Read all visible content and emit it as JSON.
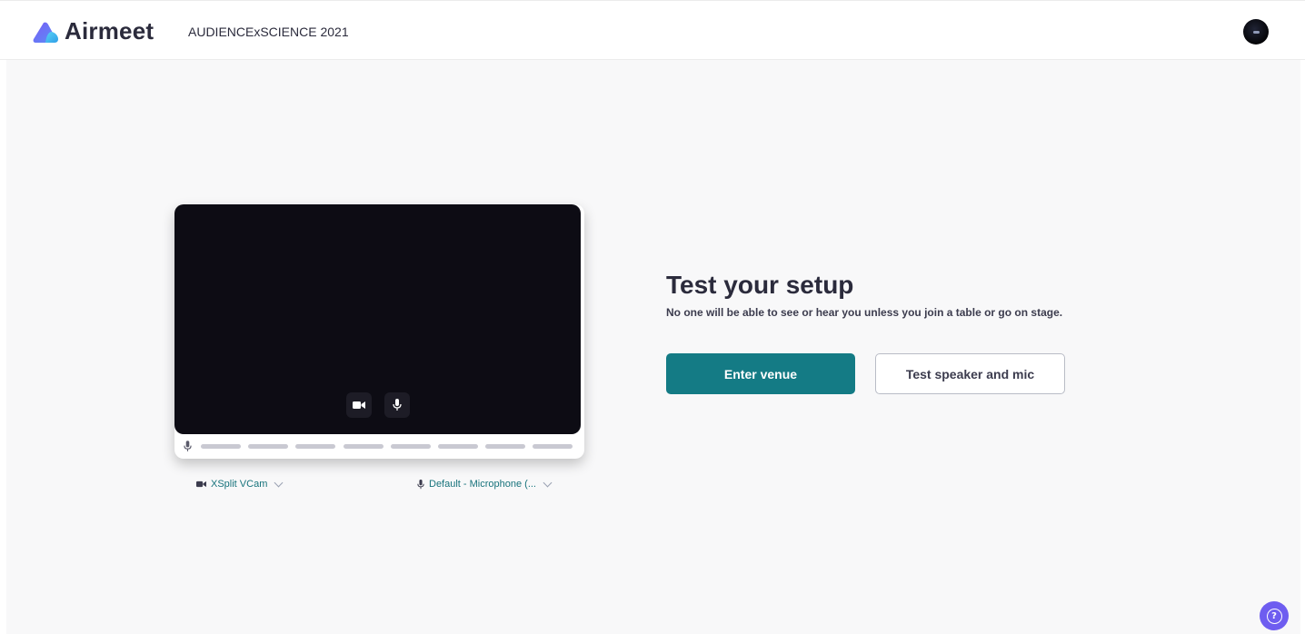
{
  "header": {
    "brand_name": "Airmeet",
    "event_title": "AUDIENCExSCIENCE 2021",
    "logo_icon": "airmeet-logo-icon",
    "avatar_icon": "user-avatar"
  },
  "preview": {
    "camera_toggle_icon": "video-camera-icon",
    "mic_toggle_icon": "microphone-icon",
    "mic_level_icon": "microphone-icon",
    "mic_level_bar_count": 8
  },
  "devices": {
    "camera_label": "XSplit VCam",
    "microphone_label": "Default - Microphone (..."
  },
  "setup": {
    "title": "Test your setup",
    "subtitle": "No one will be able to see or hear you unless you join a table or go on stage.",
    "enter_button": "Enter venue",
    "test_button": "Test speaker and mic"
  },
  "help": {
    "icon": "help-icon",
    "glyph": "?"
  },
  "colors": {
    "accent": "#147b85",
    "help_bubble": "#6e5df0",
    "video_bg": "#0d0c14",
    "page_bg": "#f8f8f9"
  }
}
